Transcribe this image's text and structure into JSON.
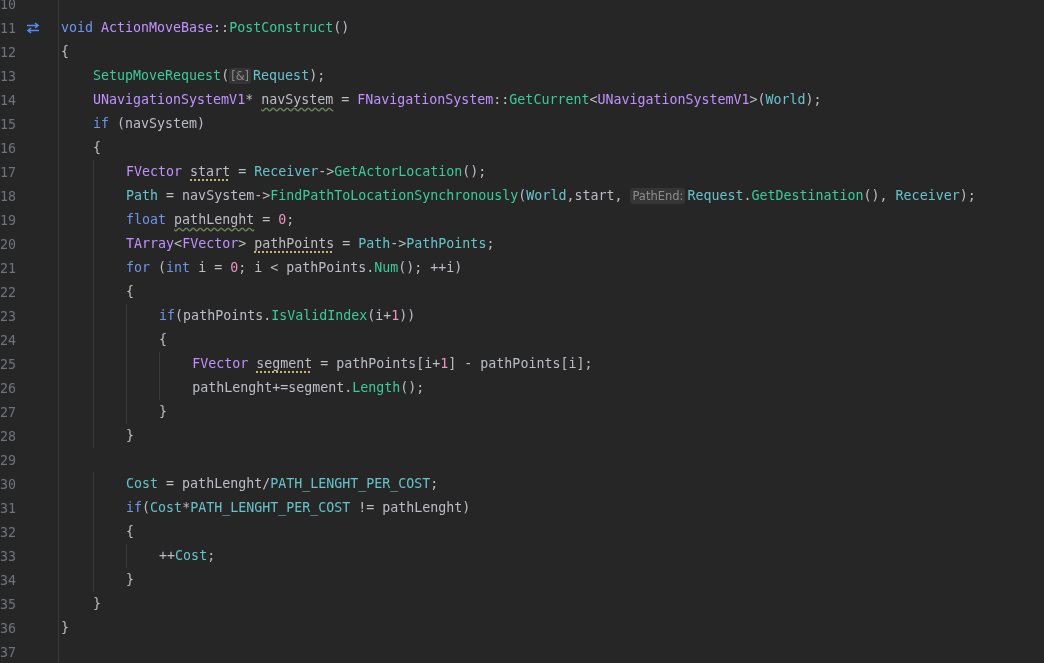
{
  "editor": {
    "lines": [
      {
        "number": "10"
      },
      {
        "number": "11",
        "override_marker": true,
        "tokens": [
          {
            "text": "void ",
            "kind": "keyword"
          },
          {
            "text": "ActionMoveBase",
            "kind": "type"
          },
          {
            "text": "::",
            "kind": "plain"
          },
          {
            "text": "PostConstruct",
            "kind": "function"
          },
          {
            "text": "()",
            "kind": "plain"
          }
        ]
      },
      {
        "number": "12",
        "tokens": [
          {
            "text": "{",
            "kind": "plain"
          }
        ]
      },
      {
        "number": "13",
        "tokens": [
          {
            "text": "    SetupMoveRequest",
            "kind": "function"
          },
          {
            "text": "(",
            "kind": "plain"
          },
          {
            "text": "[&]",
            "kind": "hint"
          },
          {
            "text": "Request",
            "kind": "field"
          },
          {
            "text": ");",
            "kind": "plain"
          }
        ]
      },
      {
        "number": "14",
        "tokens": [
          {
            "text": "    UNavigationSystemV1",
            "kind": "type"
          },
          {
            "text": "* ",
            "kind": "plain"
          },
          {
            "text": "navSystem",
            "kind": "local",
            "squiggly": true
          },
          {
            "text": " = ",
            "kind": "plain"
          },
          {
            "text": "FNavigationSystem",
            "kind": "type"
          },
          {
            "text": "::",
            "kind": "plain"
          },
          {
            "text": "GetCurrent",
            "kind": "function"
          },
          {
            "text": "<",
            "kind": "plain"
          },
          {
            "text": "UNavigationSystemV1",
            "kind": "type"
          },
          {
            "text": ">(",
            "kind": "plain"
          },
          {
            "text": "World",
            "kind": "field"
          },
          {
            "text": ");",
            "kind": "plain"
          }
        ]
      },
      {
        "number": "15",
        "tokens": [
          {
            "text": "    if",
            "kind": "keyword"
          },
          {
            "text": " (navSystem)",
            "kind": "plain"
          }
        ]
      },
      {
        "number": "16",
        "tokens": [
          {
            "text": "    {",
            "kind": "plain"
          }
        ]
      },
      {
        "number": "17",
        "tokens": [
          {
            "text": "        FVector ",
            "kind": "type"
          },
          {
            "text": "start",
            "kind": "local",
            "dotted": true
          },
          {
            "text": " = ",
            "kind": "plain"
          },
          {
            "text": "Receiver",
            "kind": "field"
          },
          {
            "text": "->",
            "kind": "plain"
          },
          {
            "text": "GetActorLocation",
            "kind": "function"
          },
          {
            "text": "();",
            "kind": "plain"
          }
        ]
      },
      {
        "number": "18",
        "tokens": [
          {
            "text": "        Path",
            "kind": "field"
          },
          {
            "text": " = navSystem->",
            "kind": "plain"
          },
          {
            "text": "FindPathToLocationSynchronously",
            "kind": "function"
          },
          {
            "text": "(",
            "kind": "plain"
          },
          {
            "text": "World",
            "kind": "field"
          },
          {
            "text": ",start, ",
            "kind": "plain"
          },
          {
            "text": "PathEnd:",
            "kind": "hint"
          },
          {
            "text": "Request",
            "kind": "field"
          },
          {
            "text": ".",
            "kind": "plain"
          },
          {
            "text": "GetDestination",
            "kind": "function"
          },
          {
            "text": "(), ",
            "kind": "plain"
          },
          {
            "text": "Receiver",
            "kind": "field"
          },
          {
            "text": ");",
            "kind": "plain"
          }
        ]
      },
      {
        "number": "19",
        "tokens": [
          {
            "text": "        float ",
            "kind": "keyword"
          },
          {
            "text": "pathLenght",
            "kind": "local",
            "squiggly": true
          },
          {
            "text": " = ",
            "kind": "plain"
          },
          {
            "text": "0",
            "kind": "number"
          },
          {
            "text": ";",
            "kind": "plain"
          }
        ]
      },
      {
        "number": "20",
        "tokens": [
          {
            "text": "        TArray",
            "kind": "type"
          },
          {
            "text": "<",
            "kind": "plain"
          },
          {
            "text": "FVector",
            "kind": "type"
          },
          {
            "text": "> ",
            "kind": "plain"
          },
          {
            "text": "pathPoints",
            "kind": "local",
            "dotted": true
          },
          {
            "text": " = ",
            "kind": "plain"
          },
          {
            "text": "Path",
            "kind": "field"
          },
          {
            "text": "->",
            "kind": "plain"
          },
          {
            "text": "PathPoints",
            "kind": "field"
          },
          {
            "text": ";",
            "kind": "plain"
          }
        ]
      },
      {
        "number": "21",
        "tokens": [
          {
            "text": "        for",
            "kind": "keyword"
          },
          {
            "text": " (",
            "kind": "plain"
          },
          {
            "text": "int",
            "kind": "keyword"
          },
          {
            "text": " i = ",
            "kind": "plain"
          },
          {
            "text": "0",
            "kind": "number"
          },
          {
            "text": "; i < pathPoints.",
            "kind": "plain"
          },
          {
            "text": "Num",
            "kind": "function"
          },
          {
            "text": "(); ++i)",
            "kind": "plain"
          }
        ]
      },
      {
        "number": "22",
        "tokens": [
          {
            "text": "        {",
            "kind": "plain"
          }
        ]
      },
      {
        "number": "23",
        "tokens": [
          {
            "text": "            if",
            "kind": "keyword"
          },
          {
            "text": "(pathPoints.",
            "kind": "plain"
          },
          {
            "text": "IsValidIndex",
            "kind": "function"
          },
          {
            "text": "(i+",
            "kind": "plain"
          },
          {
            "text": "1",
            "kind": "number"
          },
          {
            "text": "))",
            "kind": "plain"
          }
        ]
      },
      {
        "number": "24",
        "tokens": [
          {
            "text": "            {",
            "kind": "plain"
          }
        ]
      },
      {
        "number": "25",
        "tokens": [
          {
            "text": "                FVector ",
            "kind": "type"
          },
          {
            "text": "segment",
            "kind": "local",
            "dotted": true
          },
          {
            "text": " = pathPoints[i+",
            "kind": "plain"
          },
          {
            "text": "1",
            "kind": "number"
          },
          {
            "text": "] - pathPoints[i];",
            "kind": "plain"
          }
        ]
      },
      {
        "number": "26",
        "tokens": [
          {
            "text": "                pathLenght+=segment.",
            "kind": "plain"
          },
          {
            "text": "Length",
            "kind": "function"
          },
          {
            "text": "();",
            "kind": "plain"
          }
        ]
      },
      {
        "number": "27",
        "tokens": [
          {
            "text": "            }",
            "kind": "plain"
          }
        ]
      },
      {
        "number": "28",
        "tokens": [
          {
            "text": "        }",
            "kind": "plain"
          }
        ]
      },
      {
        "number": "29"
      },
      {
        "number": "30",
        "tokens": [
          {
            "text": "        Cost",
            "kind": "field"
          },
          {
            "text": " = pathLenght/",
            "kind": "plain"
          },
          {
            "text": "PATH_LENGHT_PER_COST",
            "kind": "macro"
          },
          {
            "text": ";",
            "kind": "plain"
          }
        ]
      },
      {
        "number": "31",
        "tokens": [
          {
            "text": "        if",
            "kind": "keyword"
          },
          {
            "text": "(",
            "kind": "plain"
          },
          {
            "text": "Cost",
            "kind": "field"
          },
          {
            "text": "*",
            "kind": "plain"
          },
          {
            "text": "PATH_LENGHT_PER_COST",
            "kind": "macro"
          },
          {
            "text": " != pathLenght)",
            "kind": "plain"
          }
        ]
      },
      {
        "number": "32",
        "tokens": [
          {
            "text": "        {",
            "kind": "plain"
          }
        ]
      },
      {
        "number": "33",
        "tokens": [
          {
            "text": "            ++",
            "kind": "plain"
          },
          {
            "text": "Cost",
            "kind": "field"
          },
          {
            "text": ";",
            "kind": "plain"
          }
        ]
      },
      {
        "number": "34",
        "tokens": [
          {
            "text": "        }",
            "kind": "plain"
          }
        ]
      },
      {
        "number": "35",
        "tokens": [
          {
            "text": "    }",
            "kind": "plain"
          }
        ]
      },
      {
        "number": "36",
        "tokens": [
          {
            "text": "}",
            "kind": "plain"
          }
        ]
      },
      {
        "number": "37"
      }
    ]
  }
}
